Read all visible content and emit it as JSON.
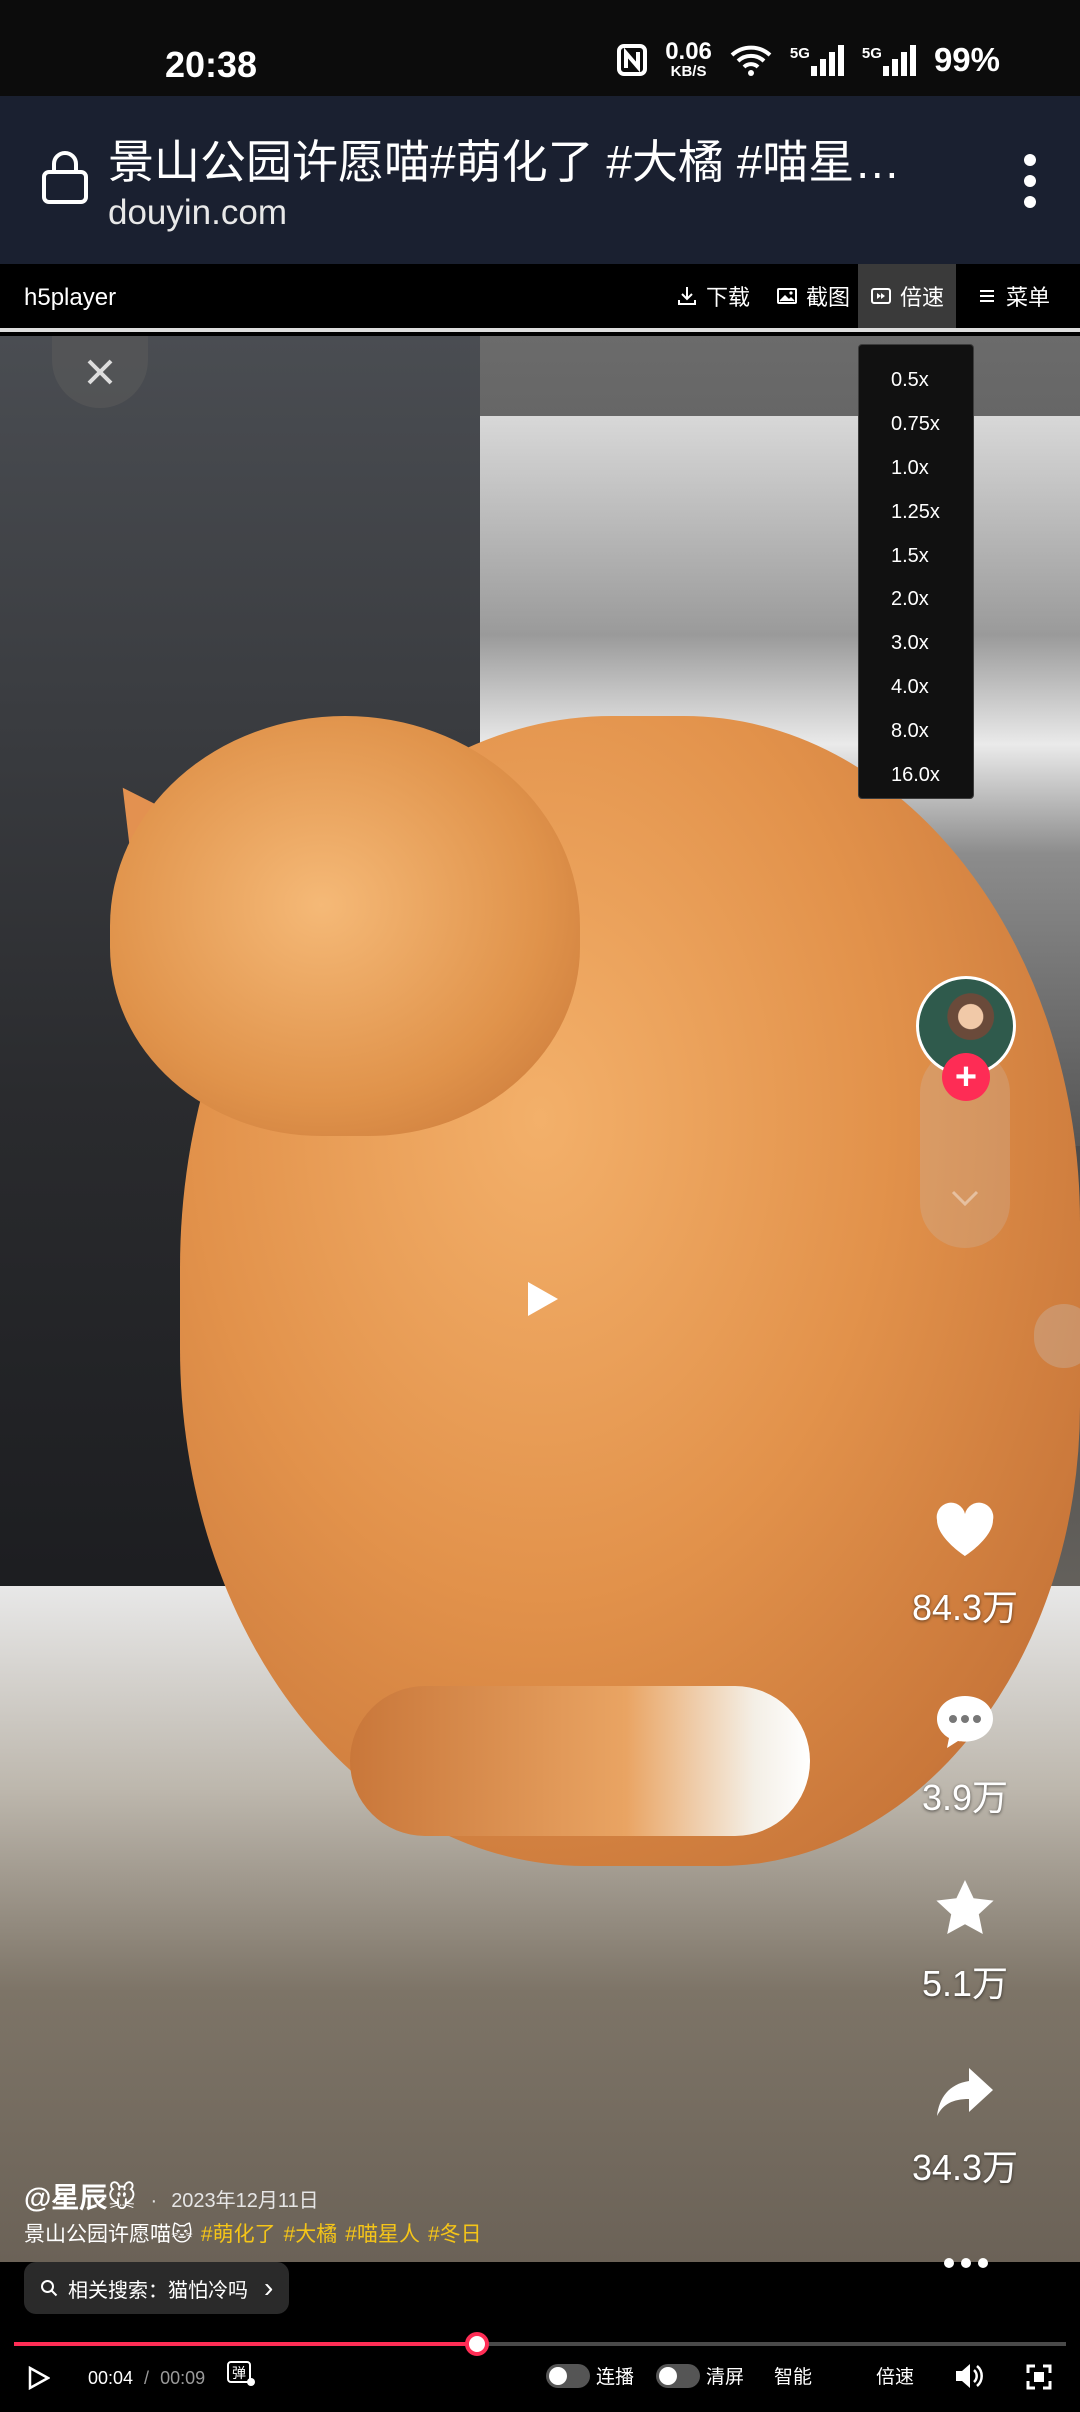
{
  "status_bar": {
    "time": "20:38",
    "net_speed_value": "0.06",
    "net_speed_unit": "KB/S",
    "sim1_label": "5G",
    "sim2_label": "5G",
    "battery": "99%"
  },
  "address_bar": {
    "title": "景山公园许愿喵#萌化了 #大橘 #喵星…",
    "url": "douyin.com"
  },
  "player_toolbar": {
    "brand": "h5player",
    "download_label": "下载",
    "screenshot_label": "截图",
    "speed_label": "倍速",
    "menu_label": "菜单"
  },
  "speed_menu": {
    "options": [
      "0.5x",
      "0.75x",
      "1.0x",
      "1.25x",
      "1.5x",
      "2.0x",
      "3.0x",
      "4.0x",
      "8.0x",
      "16.0x"
    ]
  },
  "actions": {
    "like_count": "84.3万",
    "comment_count": "3.9万",
    "favorite_count": "5.1万",
    "share_count": "34.3万"
  },
  "caption": {
    "author": "@星辰🐭",
    "separator": "·",
    "date": "2023年12月11日",
    "text": "景山公园许愿喵🐱",
    "hashtags": [
      "#萌化了",
      "#大橘",
      "#喵星人",
      "#冬日"
    ]
  },
  "related_search": {
    "label": "相关搜索：猫怕冷吗",
    "arrow": "›"
  },
  "playback": {
    "current_time": "00:04",
    "separator": " / ",
    "duration": "00:09",
    "progress_fraction": 0.44
  },
  "controls": {
    "autoplay_label": "连播",
    "clear_screen_label": "清屏",
    "smart_label": "智能",
    "speed_label": "倍速",
    "danmaku_icon_text": "弹"
  }
}
